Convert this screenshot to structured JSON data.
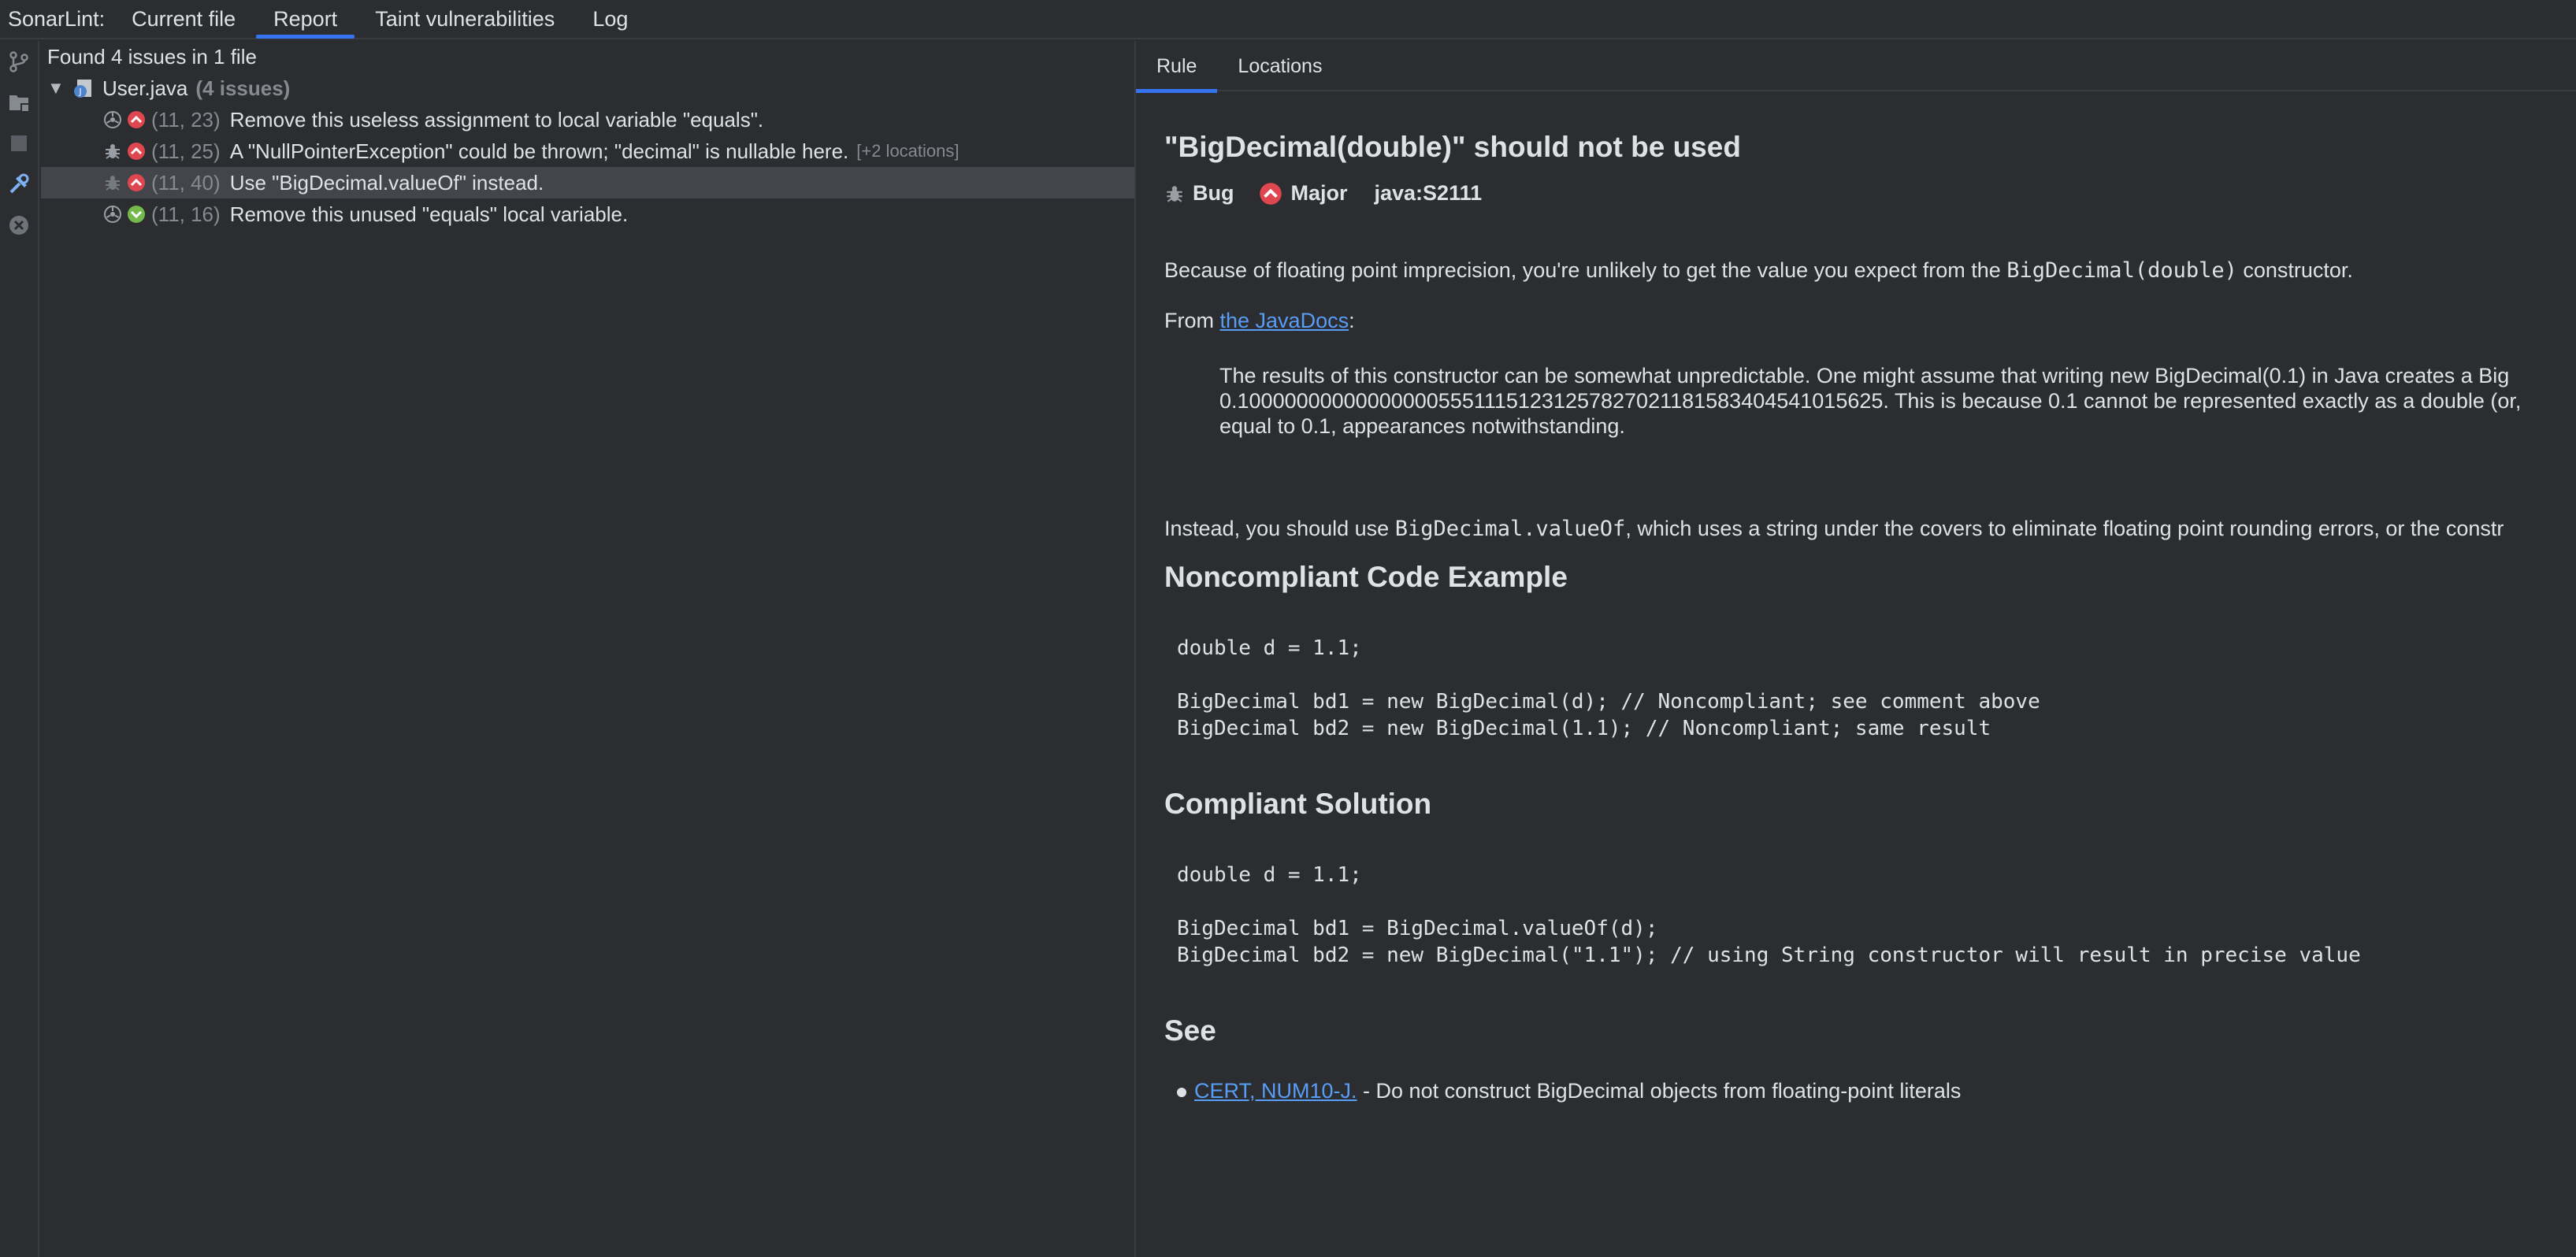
{
  "topbar": {
    "app_label": "SonarLint:",
    "tabs": [
      "Current file",
      "Report",
      "Taint vulnerabilities",
      "Log"
    ],
    "active_tab": "Report"
  },
  "sidebar_tools": [
    "branch-icon",
    "folder-icon",
    "stop-icon",
    "settings-tools-icon",
    "close-circle-icon"
  ],
  "tree": {
    "summary": "Found 4 issues in 1 file",
    "file": {
      "name": "User.java",
      "count_label": "(4 issues)"
    },
    "issues": [
      {
        "type_icon": "code-smell-icon",
        "severity": "critical",
        "location": "(11, 23)",
        "message": "Remove this useless assignment to local variable \"equals\".",
        "extra": "",
        "selected": false
      },
      {
        "type_icon": "bug-icon",
        "severity": "critical",
        "location": "(11, 25)",
        "message": "A \"NullPointerException\" could be thrown; \"decimal\" is nullable here.",
        "extra": "[+2 locations]",
        "selected": false
      },
      {
        "type_icon": "bug-icon",
        "severity": "critical",
        "location": "(11, 40)",
        "message": "Use \"BigDecimal.valueOf\" instead.",
        "extra": "",
        "selected": true
      },
      {
        "type_icon": "code-smell-icon",
        "severity": "minor",
        "location": "(11, 16)",
        "message": "Remove this unused \"equals\" local variable.",
        "extra": "",
        "selected": false
      }
    ]
  },
  "detail": {
    "tabs": [
      "Rule",
      "Locations"
    ],
    "active_tab": "Rule",
    "title": "\"BigDecimal(double)\" should not be used",
    "type_label": "Bug",
    "severity_label": "Major",
    "rule_key": "java:S2111",
    "para1_pre": "Because of floating point imprecision, you're unlikely to get the value you expect from the ",
    "para1_code": "BigDecimal(double)",
    "para1_post": " constructor.",
    "from_pre": "From ",
    "from_link": "the JavaDocs",
    "from_post": ":",
    "quote_lines": [
      "The results of this constructor can be somewhat unpredictable. One might assume that writing new BigDecimal(0.1) in Java creates a Big",
      "0.1000000000000000055511151231257827021181583404541015625. This is because 0.1 cannot be represented exactly as a double (or,",
      "equal to 0.1, appearances notwithstanding."
    ],
    "para2_pre": "Instead, you should use ",
    "para2_code": "BigDecimal.valueOf",
    "para2_post": ", which uses a string under the covers to eliminate floating point rounding errors, or the constr",
    "noncompliant_heading": "Noncompliant Code Example",
    "noncompliant_code": [
      "double d = 1.1;",
      "",
      "BigDecimal bd1 = new BigDecimal(d); // Noncompliant; see comment above",
      "BigDecimal bd2 = new BigDecimal(1.1); // Noncompliant; same result"
    ],
    "compliant_heading": "Compliant Solution",
    "compliant_code": [
      "double d = 1.1;",
      "",
      "BigDecimal bd1 = BigDecimal.valueOf(d);",
      "BigDecimal bd2 = new BigDecimal(\"1.1\"); // using String constructor will result in precise value"
    ],
    "see_heading": "See",
    "see_link": "CERT, NUM10-J.",
    "see_text": " - Do not construct BigDecimal objects from floating-point literals"
  },
  "colors": {
    "background": "#2b2d30",
    "selection": "#43454a",
    "accent": "#3574f0",
    "link": "#589df6",
    "critical": "#e0464f",
    "minor": "#75b84b",
    "muted": "#868a91"
  }
}
